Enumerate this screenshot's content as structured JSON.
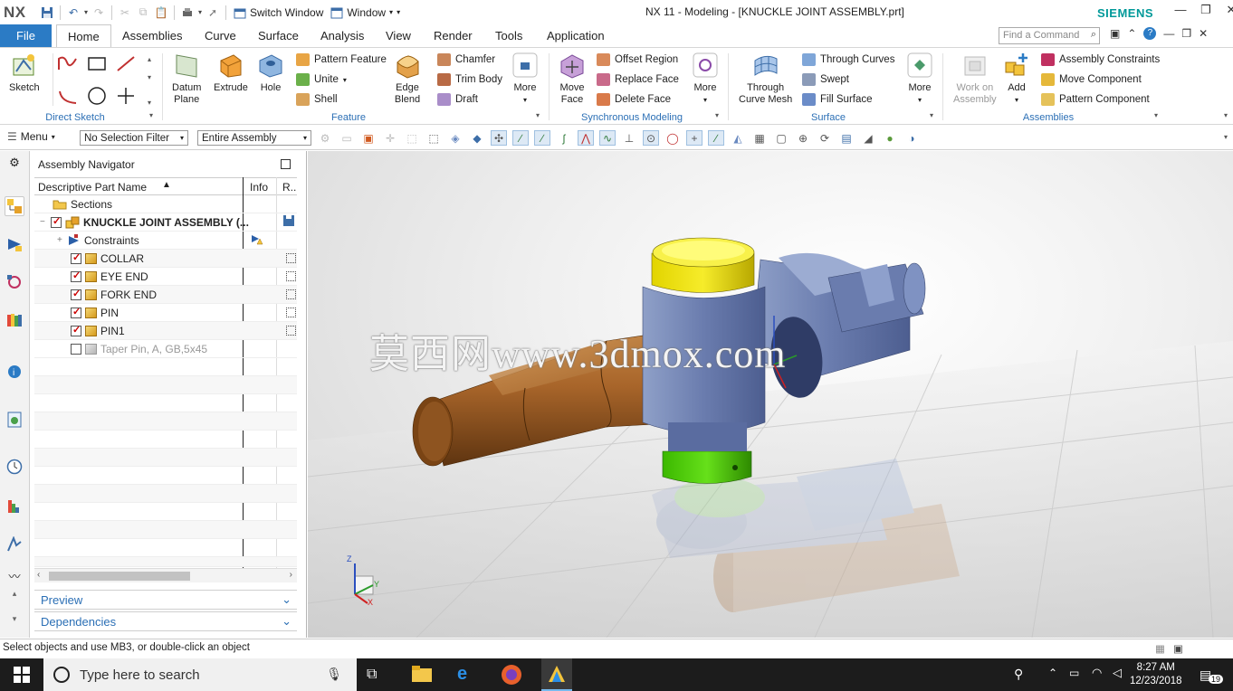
{
  "app": {
    "logo": "NX",
    "title": "NX 11 - Modeling - [KNUCKLE JOINT ASSEMBLY.prt]",
    "brand": "SIEMENS"
  },
  "quick_access": {
    "switch_window": "Switch Window",
    "window": "Window"
  },
  "tabs": {
    "file": "File",
    "items": [
      "Home",
      "Assemblies",
      "Curve",
      "Surface",
      "Analysis",
      "View",
      "Render",
      "Tools",
      "Application"
    ]
  },
  "find_command": {
    "placeholder": "Find a Command"
  },
  "ribbon": {
    "direct_sketch": {
      "label": "Direct Sketch",
      "sketch": "Sketch"
    },
    "feature": {
      "label": "Feature",
      "datum_plane": [
        "Datum",
        "Plane"
      ],
      "extrude": "Extrude",
      "hole": "Hole",
      "pattern_feature": "Pattern Feature",
      "unite": "Unite",
      "shell": "Shell",
      "edge_blend": [
        "Edge",
        "Blend"
      ],
      "chamfer": "Chamfer",
      "trim_body": "Trim Body",
      "draft": "Draft",
      "more": "More"
    },
    "sync": {
      "label": "Synchronous Modeling",
      "move_face": [
        "Move",
        "Face"
      ],
      "offset_region": "Offset Region",
      "replace_face": "Replace Face",
      "delete_face": "Delete Face",
      "more": "More"
    },
    "surface": {
      "label": "Surface",
      "through_curve_mesh": [
        "Through",
        "Curve Mesh"
      ],
      "through_curves": "Through Curves",
      "swept": "Swept",
      "fill_surface": "Fill Surface",
      "more": "More"
    },
    "assemblies": {
      "label": "Assemblies",
      "work_on_assembly": [
        "Work on",
        "Assembly"
      ],
      "add": "Add",
      "assembly_constraints": "Assembly Constraints",
      "move_component": "Move Component",
      "pattern_component": "Pattern Component"
    }
  },
  "command_bar": {
    "menu": "Menu",
    "selection_filter": "No Selection Filter",
    "scope": "Entire Assembly"
  },
  "navigator": {
    "title": "Assembly Navigator",
    "columns": {
      "name": "Descriptive Part Name",
      "info": "Info",
      "r": "R.."
    },
    "rows": [
      {
        "name": "Sections"
      },
      {
        "name": "KNUCKLE JOINT ASSEMBLY (..."
      },
      {
        "name": "Constraints"
      },
      {
        "name": "COLLAR"
      },
      {
        "name": "EYE END"
      },
      {
        "name": "FORK END"
      },
      {
        "name": "PIN"
      },
      {
        "name": "PIN1"
      },
      {
        "name": "Taper Pin, A, GB,5x45"
      }
    ],
    "preview": "Preview",
    "dependencies": "Dependencies"
  },
  "viewport": {
    "watermark": "莫西网www.3dmox.com",
    "triad": {
      "z": "Z",
      "y": "Y",
      "x": "X"
    }
  },
  "status": {
    "message": "Select objects and use MB3, or double-click an object"
  },
  "taskbar": {
    "search": "Type here to search",
    "time": "8:27 AM",
    "date": "12/23/2018",
    "notifications": "19"
  },
  "colors": {
    "accent": "#2b7bc5",
    "brand": "#009999",
    "label_blue": "#2b6fb5"
  }
}
